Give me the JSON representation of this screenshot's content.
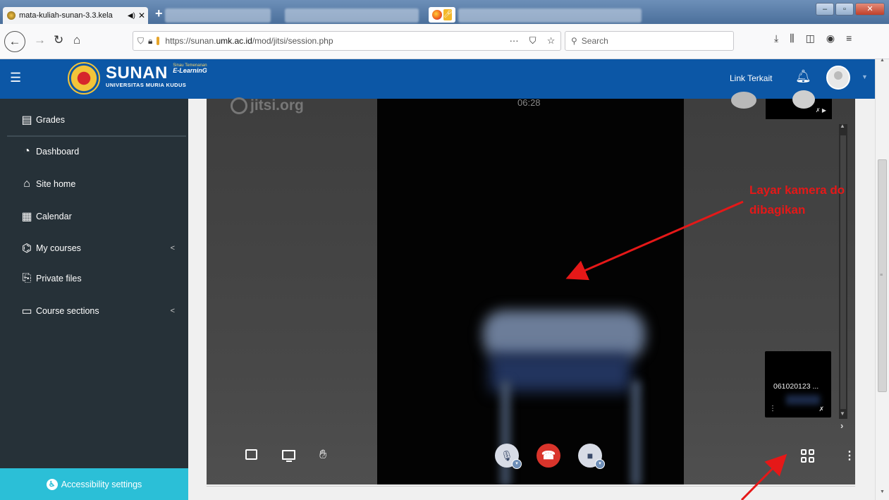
{
  "browser": {
    "tab_title": "mata-kuliah-sunan-3.3.kela",
    "tab_audio_icon": "speaker-icon",
    "url_prefix": "https://sunan.",
    "url_domain": "umk.ac.id",
    "url_path": "/mod/jitsi/session.php",
    "search_placeholder": "Search"
  },
  "header": {
    "brand_name": "SUNAN",
    "brand_tagline": "Sinau Temenanan",
    "brand_elearning": "E-LearninG",
    "brand_university": "UNIVERSITAS MURIA KUDUS",
    "link_terkait": "Link Terkait"
  },
  "sidebar": {
    "items": [
      {
        "label": "Grades",
        "icon": "grades-icon"
      },
      {
        "label": "Dashboard",
        "icon": "dashboard-icon"
      },
      {
        "label": "Site home",
        "icon": "home-icon"
      },
      {
        "label": "Calendar",
        "icon": "calendar-icon"
      },
      {
        "label": "My courses",
        "icon": "graduation-cap-icon"
      },
      {
        "label": "Private files",
        "icon": "files-icon"
      },
      {
        "label": "Course sections",
        "icon": "folder-icon"
      }
    ],
    "accessibility": "Accessibility settings"
  },
  "meeting": {
    "watermark": "jitsi.org",
    "timer": "06:28",
    "participant_name": "061020123 ...",
    "colors": {
      "hangup": "#d9342b",
      "header": "#0c57a6",
      "sidebar": "#263138",
      "accessibility": "#2bbfd7"
    }
  },
  "annotation": {
    "line1": "Layar kamera do",
    "line2": "dibagikan",
    "color": "#e51818"
  }
}
